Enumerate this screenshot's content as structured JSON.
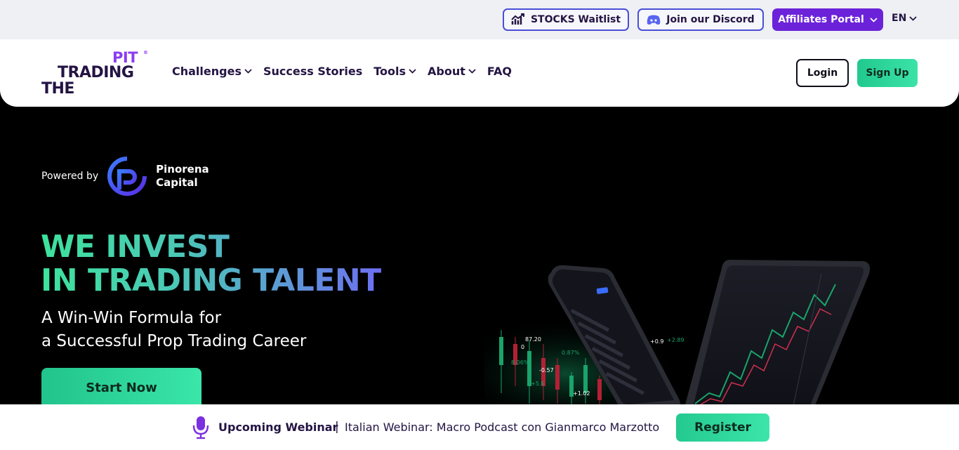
{
  "topbar": {
    "stocks_label": "STOCKS Waitlist",
    "discord_label": "Join our Discord",
    "affiliates_label": "Affiliates Portal",
    "language": "EN"
  },
  "logo": {
    "line1": "PIT",
    "line2": "TRADING",
    "line3": "THE",
    "mark": "®"
  },
  "nav": {
    "challenges": "Challenges",
    "success_stories": "Success Stories",
    "tools": "Tools",
    "about": "About",
    "faq": "FAQ",
    "login": "Login",
    "signup": "Sign Up"
  },
  "hero": {
    "powered_by": "Powered by",
    "partner_line1": "Pinorena",
    "partner_line2": "Capital",
    "headline_line1": "WE INVEST",
    "headline_line2": "IN TRADING TALENT",
    "sub_line1": "A Win-Win Formula for",
    "sub_line2": "a Successful Prop Trading Career",
    "cta": "Start Now"
  },
  "chart_labels": [
    "87.20",
    "0",
    "8.06%",
    "0.87%",
    "-0.57",
    "+5.6",
    "+1.02",
    "+0.9",
    "+2.89"
  ],
  "webinar": {
    "title": "Upcoming Webinar",
    "separator": "|",
    "description": "Italian Webinar: Macro Podcast con Gianmarco Marzotto",
    "register": "Register"
  },
  "colors": {
    "accent_purple": "#6c22d9",
    "accent_green": "#2fd69b",
    "navy": "#241443",
    "outline_blue": "#4a4fd6"
  }
}
